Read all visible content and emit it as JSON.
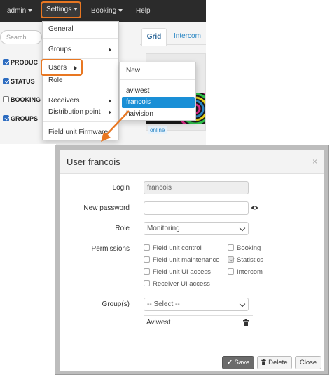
{
  "navbar": {
    "admin_label": "admin",
    "settings_label": "Settings",
    "booking_label": "Booking",
    "help_label": "Help"
  },
  "sidebar": {
    "search_placeholder": "Search",
    "filters": [
      {
        "label": "PRODUC",
        "checked": true
      },
      {
        "label": "STATUS",
        "checked": true
      },
      {
        "label": "BOOKING",
        "checked": false
      },
      {
        "label": "GROUPS",
        "checked": true
      }
    ]
  },
  "view_tabs": {
    "grid": "Grid",
    "intercom": "Intercom"
  },
  "tile": {
    "status": "online"
  },
  "settings_menu": {
    "items": [
      {
        "label": "General"
      },
      {
        "label": "Groups"
      },
      {
        "label": "Users"
      },
      {
        "label": "Role"
      },
      {
        "label": "Receivers"
      },
      {
        "label": "Distribution point"
      },
      {
        "label": "Field unit Firmware"
      }
    ]
  },
  "users_submenu": {
    "new_label": "New",
    "users": [
      "aviwest",
      "francois",
      "haivision"
    ],
    "selected": "francois"
  },
  "dialog": {
    "title": "User francois",
    "login_label": "Login",
    "login_value": "francois",
    "password_label": "New password",
    "password_value": "",
    "role_label": "Role",
    "role_value": "Monitoring",
    "permissions_label": "Permissions",
    "permissions_left": [
      {
        "label": "Field unit control",
        "checked": false
      },
      {
        "label": "Field unit maintenance",
        "checked": false
      },
      {
        "label": "Field unit UI access",
        "checked": false
      },
      {
        "label": "Receiver UI access",
        "checked": false
      }
    ],
    "permissions_right": [
      {
        "label": "Booking",
        "checked": false
      },
      {
        "label": "Statistics",
        "checked": true
      },
      {
        "label": "Intercom",
        "checked": false
      }
    ],
    "groups_label": "Group(s)",
    "groups_select_value": "-- Select --",
    "group_rows": [
      "Aviwest"
    ],
    "save_label": "Save",
    "delete_label": "Delete",
    "close_label": "Close"
  },
  "colors": {
    "navbar_bg": "#2b2b2b",
    "highlight_orange": "#e87722",
    "selected_blue": "#1a8fd6",
    "link_blue": "#2a86c4"
  }
}
